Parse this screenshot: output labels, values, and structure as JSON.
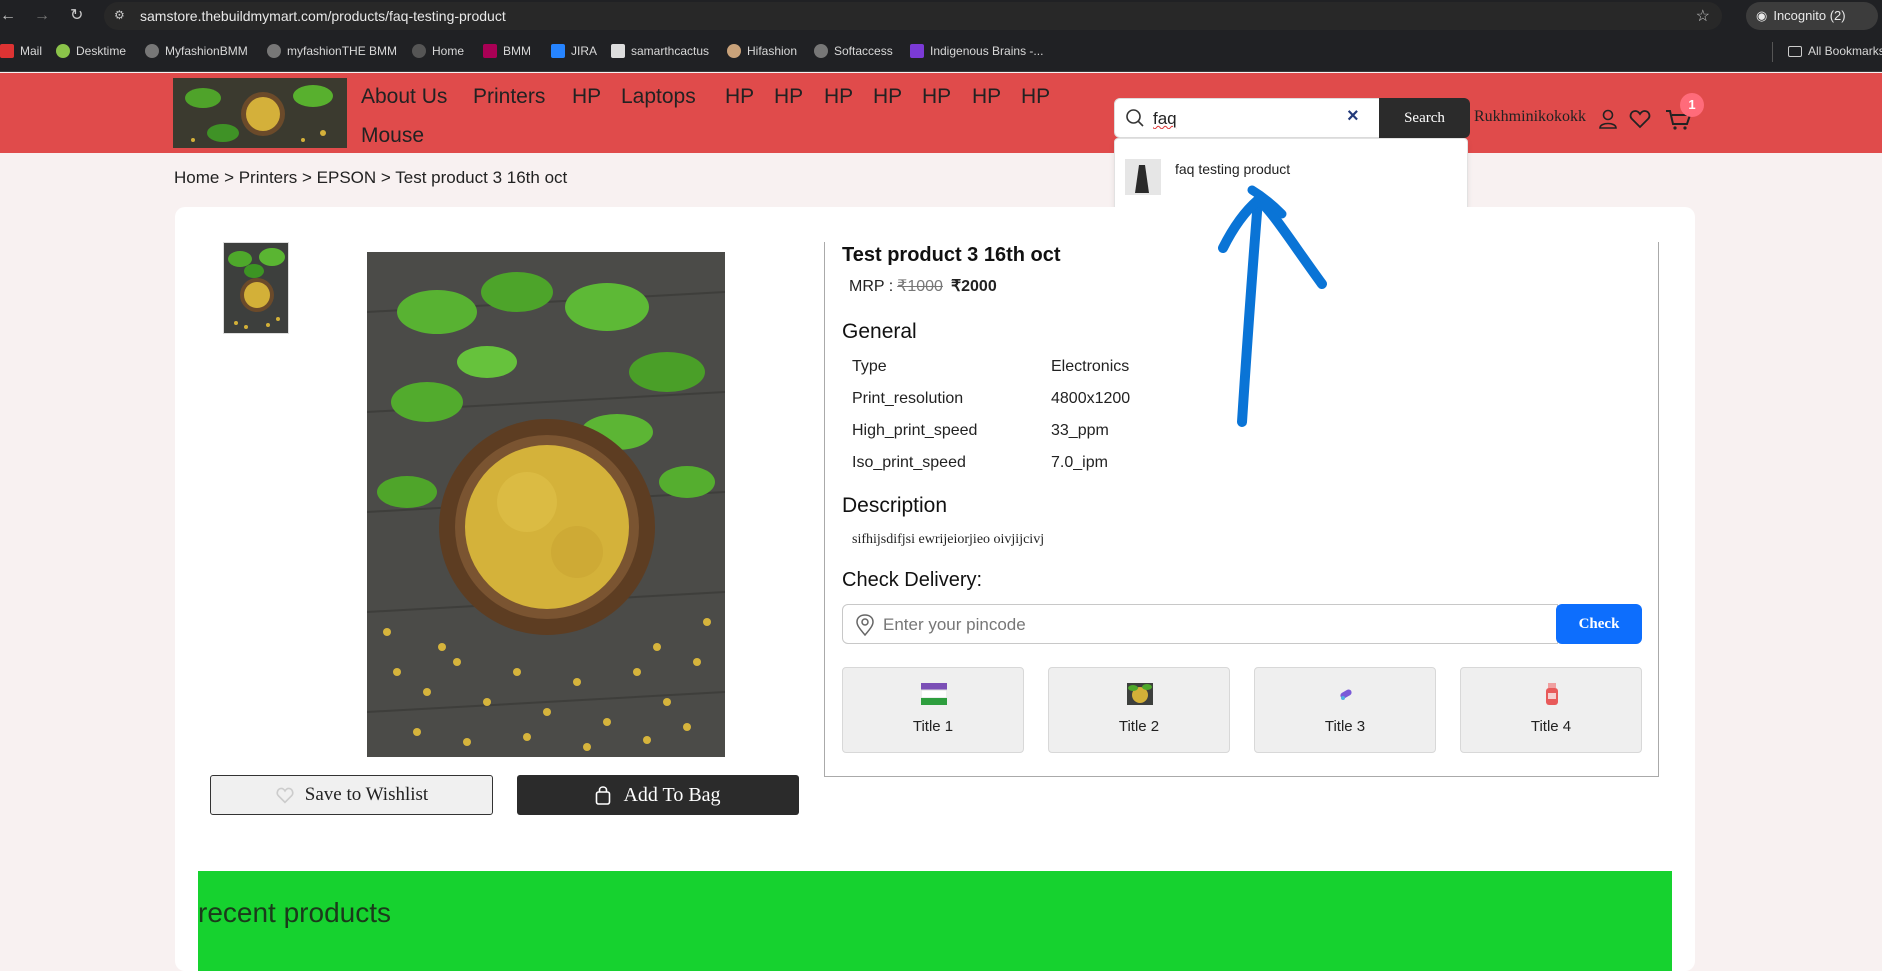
{
  "browser": {
    "url": "samstore.thebuildmymart.com/products/faq-testing-product",
    "incognito_label": "Incognito (2)",
    "bookmarks": [
      "Mail",
      "Desktime",
      "MyfashionBMM",
      "myfashionTHE BMM",
      "Home",
      "BMM",
      "JIRA",
      "samarthcactus",
      "Hifashion",
      "Softaccess",
      "Indigenous Brains -..."
    ],
    "all_bookmarks_label": "All Bookmarks"
  },
  "header": {
    "nav": [
      "About Us",
      "Printers",
      "HP",
      "Laptops",
      "HP",
      "HP",
      "HP",
      "HP",
      "HP",
      "HP",
      "HP",
      "Mouse"
    ],
    "search": {
      "value": "faq",
      "button_label": "Search"
    },
    "account_name": "Rukhminikokokk",
    "cart_count": "1"
  },
  "search_suggestions": [
    {
      "label": "faq testing product"
    }
  ],
  "breadcrumb": "Home > Printers > EPSON > Test product 3 16th oct",
  "product": {
    "title": "Test product 3 16th oct",
    "mrp_label": "MRP :",
    "mrp_old": "₹1000",
    "mrp_new": "₹2000",
    "general_heading": "General",
    "specs": [
      {
        "key": "Type",
        "value": "Electronics"
      },
      {
        "key": "Print_resolution",
        "value": "4800x1200"
      },
      {
        "key": "High_print_speed",
        "value": "33_ppm"
      },
      {
        "key": "Iso_print_speed",
        "value": "7.0_ipm"
      }
    ],
    "description_heading": "Description",
    "description": "sifhijsdifjsi ewrijeiorjieo oivjijcivj",
    "delivery_heading": "Check Delivery:",
    "pincode_placeholder": "Enter your pincode",
    "check_label": "Check",
    "tiles": [
      "Title 1",
      "Title 2",
      "Title 3",
      "Title 4"
    ],
    "wishlist_label": "Save to Wishlist",
    "bag_label": "Add To Bag"
  },
  "recent": {
    "title": "recent products"
  },
  "colors": {
    "header_bg": "#e04b4b",
    "recent_bg": "#16d22f",
    "check_btn": "#0d6efd",
    "annotation_arrow": "#0a74d6"
  }
}
